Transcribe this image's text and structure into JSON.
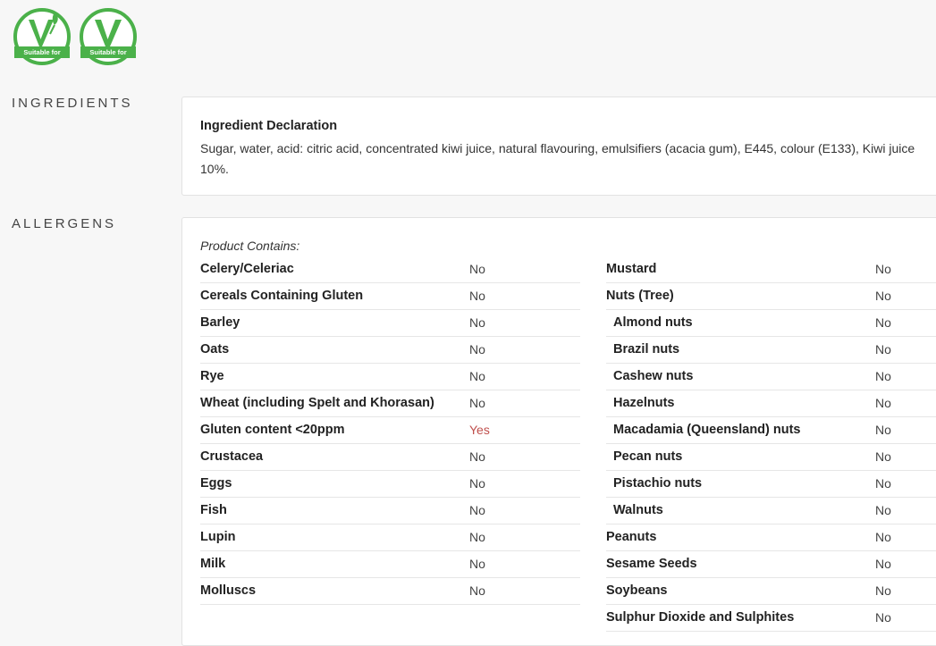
{
  "badges": [
    {
      "label": "Suitable for",
      "icon": "vegetarian-v-icon",
      "color": "#4bb14a"
    },
    {
      "label": "Suitable for",
      "icon": "vegan-v-icon",
      "color": "#4bb14a"
    }
  ],
  "ingredients": {
    "heading": "INGREDIENTS",
    "declaration_title": "Ingredient Declaration",
    "declaration_text": "Sugar, water, acid: citric acid, concentrated kiwi juice, natural flavouring, emulsifiers (acacia gum), E445, colour (E133), Kiwi juice 10%."
  },
  "allergens": {
    "heading": "ALLERGENS",
    "contains_label": "Product Contains:",
    "left": [
      {
        "name": "Celery/Celeriac",
        "value": "No"
      },
      {
        "name": "Cereals Containing Gluten",
        "value": "No"
      },
      {
        "name": "Barley",
        "value": "No"
      },
      {
        "name": "Oats",
        "value": "No"
      },
      {
        "name": "Rye",
        "value": "No"
      },
      {
        "name": "Wheat (including Spelt and Khorasan)",
        "value": "No"
      },
      {
        "name": "Gluten content <20ppm",
        "value": "Yes"
      },
      {
        "name": "Crustacea",
        "value": "No"
      },
      {
        "name": "Eggs",
        "value": "No"
      },
      {
        "name": "Fish",
        "value": "No"
      },
      {
        "name": "Lupin",
        "value": "No"
      },
      {
        "name": "Milk",
        "value": "No"
      },
      {
        "name": "Molluscs",
        "value": "No"
      }
    ],
    "right": [
      {
        "name": "Mustard",
        "value": "No"
      },
      {
        "name": "Nuts (Tree)",
        "value": "No"
      },
      {
        "name": "Almond nuts",
        "value": "No"
      },
      {
        "name": "Brazil nuts",
        "value": "No"
      },
      {
        "name": "Cashew nuts",
        "value": "No"
      },
      {
        "name": "Hazelnuts",
        "value": "No"
      },
      {
        "name": "Macadamia (Queensland) nuts",
        "value": "No"
      },
      {
        "name": "Pecan nuts",
        "value": "No"
      },
      {
        "name": "Pistachio nuts",
        "value": "No"
      },
      {
        "name": "Walnuts",
        "value": "No"
      },
      {
        "name": "Peanuts",
        "value": "No"
      },
      {
        "name": "Sesame Seeds",
        "value": "No"
      },
      {
        "name": "Soybeans",
        "value": "No"
      },
      {
        "name": "Sulphur Dioxide and Sulphites",
        "value": "No"
      }
    ],
    "yes_color": "#c0504d"
  }
}
